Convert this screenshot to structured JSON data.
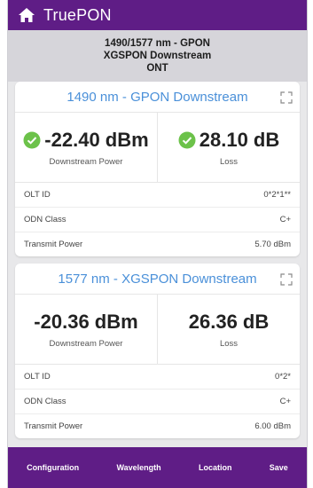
{
  "app": {
    "title": "TruePON"
  },
  "subtitle": {
    "line1": "1490/1577 nm - GPON",
    "line2": "XGSPON Downstream",
    "line3": "ONT"
  },
  "panels": [
    {
      "title": "1490 nm - GPON Downstream",
      "power": {
        "value": "-22.40 dBm",
        "label": "Downstream Power",
        "status": "pass"
      },
      "loss": {
        "value": "28.10 dB",
        "label": "Loss",
        "status": "pass"
      },
      "rows": [
        {
          "label": "OLT ID",
          "value": "0*2*1**"
        },
        {
          "label": "ODN Class",
          "value": "C+"
        },
        {
          "label": "Transmit Power",
          "value": "5.70 dBm"
        }
      ]
    },
    {
      "title": "1577 nm - XGSPON Downstream",
      "power": {
        "value": "-20.36 dBm",
        "label": "Downstream Power"
      },
      "loss": {
        "value": "26.36 dB",
        "label": "Loss"
      },
      "rows": [
        {
          "label": "OLT ID",
          "value": "0*2*"
        },
        {
          "label": "ODN Class",
          "value": "C+"
        },
        {
          "label": "Transmit Power",
          "value": "6.00 dBm"
        }
      ]
    }
  ],
  "bottom_nav": {
    "configuration": "Configuration",
    "wavelength": "Wavelength",
    "location": "Location",
    "save": "Save"
  },
  "colors": {
    "brand": "#5f1d86",
    "accent": "#4a90d9",
    "pass": "#6cc24a"
  }
}
